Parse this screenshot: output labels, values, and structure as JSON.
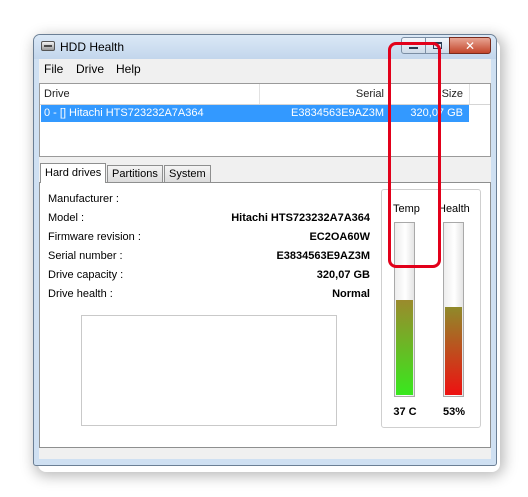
{
  "window": {
    "title": "HDD Health",
    "icon": "hdd-icon"
  },
  "menu": {
    "file": "File",
    "drive": "Drive",
    "help": "Help"
  },
  "drive_list": {
    "columns": {
      "drive": "Drive",
      "serial": "Serial",
      "size": "Size"
    },
    "rows": [
      {
        "drive": "0 - [] Hitachi HTS723232A7A364",
        "serial": "E3834563E9AZ3M",
        "size": "320,07 GB",
        "selected": true
      }
    ]
  },
  "tabs": [
    {
      "label": "Hard drives",
      "active": true
    },
    {
      "label": "Partitions",
      "active": false
    },
    {
      "label": "System",
      "active": false
    }
  ],
  "details": {
    "manufacturer": {
      "label": "Manufacturer :",
      "value": ""
    },
    "model": {
      "label": "Model :",
      "value": "Hitachi HTS723232A7A364"
    },
    "firmware": {
      "label": "Firmware revision :",
      "value": "EC2OA60W"
    },
    "serial": {
      "label": "Serial number :",
      "value": "E3834563E9AZ3M"
    },
    "capacity": {
      "label": "Drive capacity :",
      "value": "320,07 GB"
    },
    "health": {
      "label": "Drive health :",
      "value": "Normal"
    }
  },
  "gauges": {
    "temp": {
      "label": "Temp",
      "value": "37 C",
      "level_percent": 55,
      "colors": [
        "#38e81e",
        "#9b8a2c"
      ]
    },
    "health": {
      "label": "Health",
      "value": "53%",
      "level_percent": 51,
      "colors": [
        "#ee1111",
        "#8f8a2a"
      ],
      "highlight_color": "#e2001a"
    }
  }
}
